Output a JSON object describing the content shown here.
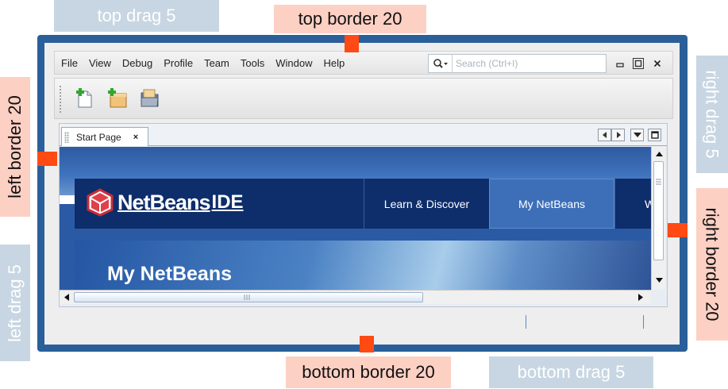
{
  "annotations": {
    "top_drag": "top drag 5",
    "top_border": "top border 20",
    "left_border": "left border 20",
    "left_drag": "left drag 5",
    "right_drag": "right drag 5",
    "right_border": "right border 20",
    "bottom_border": "bottom border 20",
    "bottom_drag": "bottom drag 5"
  },
  "colors": {
    "frame": "#2a5f9a",
    "border_label_bg": "#fdd0c4",
    "drag_label_bg": "#c7d6e2",
    "marker": "#ff4a14",
    "netbeans_navy": "#0e2d6b"
  },
  "menubar": {
    "items": [
      "File",
      "View",
      "Debug",
      "Profile",
      "Team",
      "Tools",
      "Window",
      "Help"
    ],
    "search_placeholder": "Search (Ctrl+I)"
  },
  "toolbar": {
    "icons": [
      "new-file-icon",
      "new-project-icon",
      "open-project-icon"
    ]
  },
  "editor": {
    "tab_label": "Start Page",
    "tab_close": "×"
  },
  "start_page": {
    "logo": "NetBeans",
    "logo_suffix": "IDE",
    "nav": [
      "Learn & Discover",
      "My NetBeans",
      "W"
    ],
    "active_nav": "My NetBeans",
    "hero_title": "My NetBeans"
  }
}
